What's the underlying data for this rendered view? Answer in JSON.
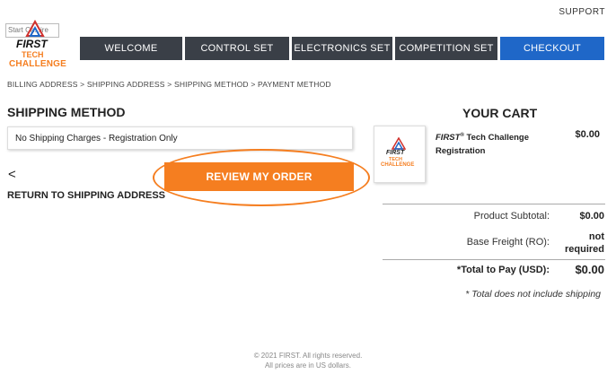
{
  "header": {
    "support_label": "SUPPORT",
    "logo": {
      "placeholder_text": "Start Ca...ire",
      "first": "FIRST",
      "tech": "TECH",
      "challenge": "CHALLENGE"
    }
  },
  "nav": [
    {
      "label": "WELCOME"
    },
    {
      "label": "CONTROL SET"
    },
    {
      "label": "ELECTRONICS SET"
    },
    {
      "label": "COMPETITION SET"
    },
    {
      "label": "CHECKOUT"
    }
  ],
  "breadcrumb": "BILLING ADDRESS > SHIPPING ADDRESS > SHIPPING METHOD > PAYMENT METHOD",
  "shipping": {
    "title": "SHIPPING METHOD",
    "selected_method": "No Shipping Charges - Registration Only",
    "back_arrow": "<",
    "return_label": "RETURN TO SHIPPING ADDRESS",
    "review_button": "REVIEW MY ORDER"
  },
  "cart": {
    "title": "YOUR CART",
    "item": {
      "name_first": "FIRST",
      "name_mark": "®",
      "name_rest": " Tech Challenge Registration",
      "price": "$0.00"
    },
    "thumb": {
      "first": "FIRST",
      "tech": "TECH",
      "challenge": "CHALLENGE"
    },
    "product_subtotal_label": "Product Subtotal:",
    "product_subtotal_value": "$0.00",
    "base_freight_label": "Base Freight (RO):",
    "base_freight_value_1": "not",
    "base_freight_value_2": "required",
    "total_label": "*Total to Pay (USD):",
    "total_value": "$0.00",
    "note": "* Total does not include shipping"
  },
  "footer": {
    "line1": "© 2021 FIRST. All rights reserved.",
    "line2": "All prices are in US dollars."
  },
  "colors": {
    "accent": "#f57e20",
    "nav_dark": "#3a3f47",
    "checkout_blue": "#1f67c8"
  }
}
